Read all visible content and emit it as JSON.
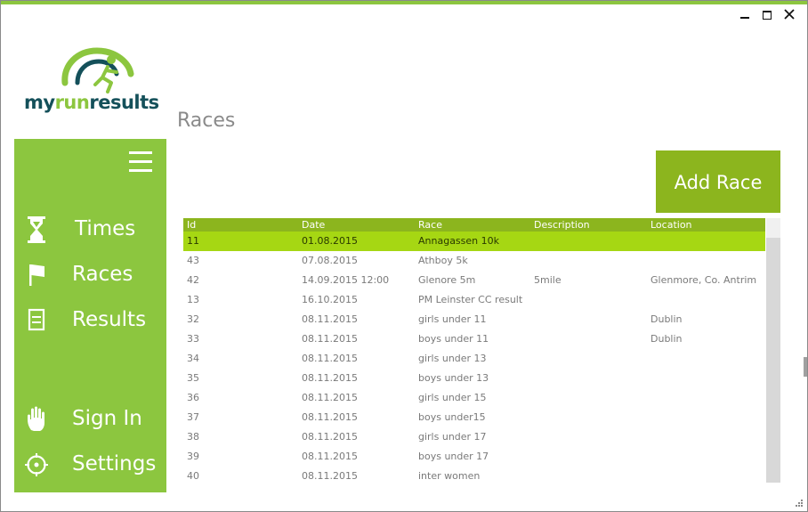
{
  "window": {
    "controls": {
      "minimize": "minimize",
      "maximize": "maximize",
      "close": "close"
    }
  },
  "logo": {
    "text_my": "my",
    "text_run": "run",
    "text_results": "results"
  },
  "sidebar": {
    "items": [
      {
        "label": "Times",
        "icon": "hourglass-icon"
      },
      {
        "label": "Races",
        "icon": "flag-icon"
      },
      {
        "label": "Results",
        "icon": "document-icon"
      },
      {
        "label": "Sign In",
        "icon": "hand-icon"
      },
      {
        "label": "Settings",
        "icon": "settings-icon"
      }
    ]
  },
  "main": {
    "title": "Races",
    "add_button": "Add Race"
  },
  "grid": {
    "columns": [
      "Id",
      "Date",
      "Race",
      "Description",
      "Location"
    ],
    "selected_index": 0,
    "rows": [
      {
        "id": "11",
        "date": "01.08.2015",
        "race": "Annagassen 10k",
        "description": "",
        "location": ""
      },
      {
        "id": "43",
        "date": "07.08.2015",
        "race": "Athboy 5k",
        "description": "",
        "location": ""
      },
      {
        "id": "42",
        "date": "14.09.2015 12:00",
        "race": "Glenore 5m",
        "description": "5mile",
        "location": "Glenmore, Co. Antrim"
      },
      {
        "id": "13",
        "date": "16.10.2015",
        "race": "PM Leinster CC result",
        "description": "",
        "location": ""
      },
      {
        "id": "32",
        "date": "08.11.2015",
        "race": "girls under 11",
        "description": "",
        "location": "Dublin"
      },
      {
        "id": "33",
        "date": "08.11.2015",
        "race": "boys under 11",
        "description": "",
        "location": "Dublin"
      },
      {
        "id": "34",
        "date": "08.11.2015",
        "race": "girls under 13",
        "description": "",
        "location": ""
      },
      {
        "id": "35",
        "date": "08.11.2015",
        "race": "boys under 13",
        "description": "",
        "location": ""
      },
      {
        "id": "36",
        "date": "08.11.2015",
        "race": "girls under 15",
        "description": "",
        "location": ""
      },
      {
        "id": "37",
        "date": "08.11.2015",
        "race": "boys under15",
        "description": "",
        "location": ""
      },
      {
        "id": "38",
        "date": "08.11.2015",
        "race": "girls under 17",
        "description": "",
        "location": ""
      },
      {
        "id": "39",
        "date": "08.11.2015",
        "race": "boys under 17",
        "description": "",
        "location": ""
      },
      {
        "id": "40",
        "date": "08.11.2015",
        "race": "inter women",
        "description": "",
        "location": ""
      }
    ]
  },
  "colors": {
    "sidebar": "#8cc63f",
    "accent": "#8cb51e",
    "selected_row": "#a6d713",
    "logo_dark": "#14505a"
  }
}
